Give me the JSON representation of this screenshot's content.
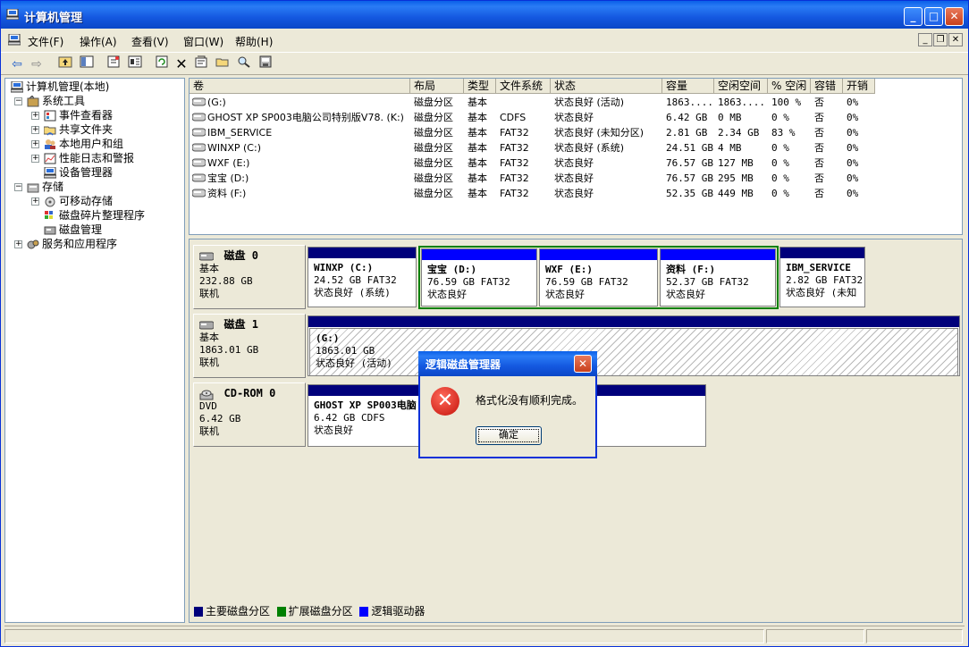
{
  "window": {
    "title": "计算机管理"
  },
  "menu": [
    "文件(F)",
    "操作(A)",
    "查看(V)",
    "窗口(W)",
    "帮助(H)"
  ],
  "tree": {
    "root": "计算机管理(本地)",
    "system_tools": "系统工具",
    "event_viewer": "事件查看器",
    "shared_folders": "共享文件夹",
    "local_users": "本地用户和组",
    "perf_logs": "性能日志和警报",
    "device_manager": "设备管理器",
    "storage": "存储",
    "removable": "可移动存储",
    "defrag": "磁盘碎片整理程序",
    "disk_mgmt": "磁盘管理",
    "services": "服务和应用程序"
  },
  "volume_list": {
    "headers": [
      "卷",
      "布局",
      "类型",
      "文件系统",
      "状态",
      "容量",
      "空闲空间",
      "% 空闲",
      "容错",
      "开销"
    ],
    "rows": [
      [
        "(G:)",
        "磁盘分区",
        "基本",
        "",
        "状态良好 (活动)",
        "1863....",
        "1863....",
        "100 %",
        "否",
        "0%"
      ],
      [
        "GHOST XP SP003电脑公司特别版V78. (K:)",
        "磁盘分区",
        "基本",
        "CDFS",
        "状态良好",
        "6.42 GB",
        "0 MB",
        "0 %",
        "否",
        "0%"
      ],
      [
        "IBM_SERVICE",
        "磁盘分区",
        "基本",
        "FAT32",
        "状态良好 (未知分区)",
        "2.81 GB",
        "2.34 GB",
        "83 %",
        "否",
        "0%"
      ],
      [
        "WINXP (C:)",
        "磁盘分区",
        "基本",
        "FAT32",
        "状态良好 (系统)",
        "24.51 GB",
        "4 MB",
        "0 %",
        "否",
        "0%"
      ],
      [
        "WXF (E:)",
        "磁盘分区",
        "基本",
        "FAT32",
        "状态良好",
        "76.57 GB",
        "127 MB",
        "0 %",
        "否",
        "0%"
      ],
      [
        "宝宝 (D:)",
        "磁盘分区",
        "基本",
        "FAT32",
        "状态良好",
        "76.57 GB",
        "295 MB",
        "0 %",
        "否",
        "0%"
      ],
      [
        "资料 (F:)",
        "磁盘分区",
        "基本",
        "FAT32",
        "状态良好",
        "52.35 GB",
        "449 MB",
        "0 %",
        "否",
        "0%"
      ]
    ]
  },
  "disks": {
    "d0": {
      "name": "磁盘 0",
      "type": "基本",
      "size": "232.88 GB",
      "status": "联机"
    },
    "d1": {
      "name": "磁盘 1",
      "type": "基本",
      "size": "1863.01 GB",
      "status": "联机"
    },
    "cd": {
      "name": "CD-ROM 0",
      "type": "DVD",
      "size": "6.42 GB",
      "status": "联机"
    }
  },
  "parts": {
    "c": {
      "name": "WINXP (C:)",
      "info": "24.52 GB FAT32",
      "status": "状态良好 (系统)"
    },
    "d": {
      "name": "宝宝 (D:)",
      "info": "76.59 GB FAT32",
      "status": "状态良好"
    },
    "e": {
      "name": "WXF (E:)",
      "info": "76.59 GB FAT32",
      "status": "状态良好"
    },
    "f": {
      "name": "资料 (F:)",
      "info": "52.37 GB FAT32",
      "status": "状态良好"
    },
    "ibm": {
      "name": "IBM_SERVICE",
      "info": "2.82 GB FAT32",
      "status": "状态良好 (未知"
    },
    "g": {
      "name": "(G:)",
      "info": "1863.01 GB",
      "status": "状态良好 (活动)"
    },
    "k": {
      "name": "GHOST XP SP003电脑",
      "info": "6.42 GB CDFS",
      "status": "状态良好"
    }
  },
  "legend": {
    "primary": "主要磁盘分区",
    "extended": "扩展磁盘分区",
    "logical": "逻辑驱动器"
  },
  "dialog": {
    "title": "逻辑磁盘管理器",
    "message": "格式化没有顺利完成。",
    "ok": "确定"
  },
  "colors": {
    "primary": "#00007b",
    "extended": "#008000",
    "logical": "#0000ff",
    "title": "#0a5fe8"
  }
}
